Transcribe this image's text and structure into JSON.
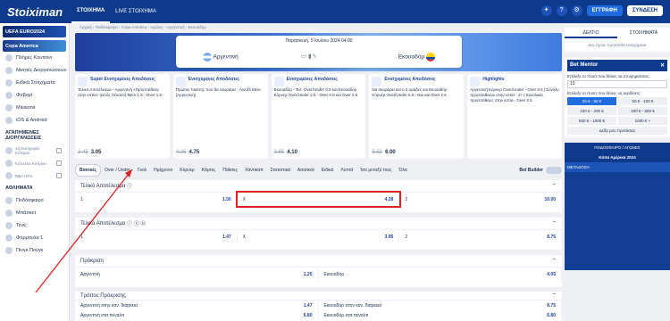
{
  "brand": "Stoiximan",
  "top_nav": [
    "ΣΤΟΙΧΗΜΑ",
    "LIVE ΣΤΟΙΧΗΜΑ"
  ],
  "top_actions": {
    "register": "ΕΓΓΡΑΦΗ",
    "login": "ΣΥΝΔΕΣΗ"
  },
  "sidebar": {
    "banners": [
      "UEFA EURO2024",
      "Copa America"
    ],
    "items": [
      "Πλήρες Κουπόνι",
      "Νικητές Διοργανώσεων",
      "Ειδικά Στοιχήματα",
      "Φαβορί",
      "Missions",
      "iOS & Android"
    ],
    "section": "ΑΓΑΠΗΜΕΝΕΣ ΔΙΟΡΓΑΝΩΣΕΙΣ",
    "favs": [
      "1η Κατηγορία Κύπρου",
      "Κύπελλο Κύπρου",
      "NBA ΗΠΑ"
    ],
    "sports_head": "ΑΘΛΗΜΑΤΑ",
    "sports": [
      "Ποδόσφαιρο",
      "Μπάσκετ",
      "Τένις",
      "Φόρμουλα 1",
      "Πινγκ Πονγκ"
    ]
  },
  "breadcrumb": "Αρχική › Ποδόσφαιρο › Copa America › Αγώνες › Αργεντινή - Εκουαδόρ",
  "event": {
    "date": "Παρασκευή, 5 Ιουλίου 2024 04:00",
    "home": "Αργεντινή",
    "away": "Εκουαδόρ"
  },
  "promos": [
    {
      "title": "Super Ενισχυμένες Αποδόσεις",
      "body": "Τελικό Αποτέλεσμα - Αργεντινή «Προσπάθειες στην εστία» (εκτός πέναλτι) Μέσι 1.5 - Over 1.5",
      "old": "2.45",
      "new": "3.05"
    },
    {
      "title": "Ενισχυμένες Αποδόσεις",
      "body": "Πρώτος παίκτης που θα σκοράρει - Λιονέλ Μέσι (Αργεντινή)",
      "old": "4.35",
      "new": "4.75"
    },
    {
      "title": "Ενισχυμένες Αποδόσεις",
      "body": "Εκουαδόρ - Τελ. Over/Under 0.5 και Εκουαδόρ Κόρνερ Over/Under 2.5 - Over 0.5 και Over 2.5",
      "old": "3.65",
      "new": "4.10"
    },
    {
      "title": "Ενισχυμένες Αποδόσεις",
      "body": "Να σκοράρει και ο 2 ομάδες και Εκουαδόρ Κόρνερ Over/Under 2.5 - Ναι και Over 2.5",
      "old": "5.50",
      "new": "6.00"
    },
    {
      "title": "Highlights",
      "body": "Αργεντινή Κόρνερ Over/Under - Over 8.5 | Σύνολο προσπαθειών στην εστία - 2+ | Συνολικές προσπάθειες στην εστία - Over 3.5",
      "old": "",
      "new": ""
    }
  ],
  "market_tabs": [
    "Βασικές",
    "Over / Under",
    "Γκολ",
    "Ημίχρονο",
    "Κόρνερ",
    "Κάρτες",
    "Παίκτες",
    "Χάντικαπ",
    "Στατιστικά",
    "Ασιατικά",
    "Ειδικά",
    "Λεπτά",
    "Ίσο μεταξύ τους",
    "Όλα"
  ],
  "bet_builder": "Bet Builder",
  "markets": [
    {
      "title": "Τελικό Αποτέλεσμα",
      "rows": [
        [
          [
            "1",
            "1.50"
          ],
          [
            "X",
            "4.28"
          ],
          [
            "2",
            "10.00"
          ]
        ]
      ]
    },
    {
      "title": "Τελικό Αποτέλεσμα",
      "rows": [
        [
          [
            "1",
            "1.47"
          ],
          [
            "X",
            "3.95"
          ],
          [
            "2",
            "8.75"
          ]
        ]
      ]
    },
    {
      "title": "Πρόκριση",
      "rows": [
        [
          [
            "Αργεντινή",
            "1.25"
          ],
          [
            "Εκουαδόρ",
            "4.05"
          ]
        ]
      ]
    },
    {
      "title": "Τρόπος Πρόκρισης",
      "rows": [
        [
          [
            "Αργεντινή στην καν. διάρκεια",
            "1.47"
          ],
          [
            "Εκουαδόρ στην καν. διάρκεια",
            "8.75"
          ]
        ],
        [
          [
            "Αργεντινή στα πέναλτι",
            "6.80"
          ],
          [
            "Εκουαδόρ στα πέναλτι",
            "6.80"
          ]
        ]
      ]
    }
  ],
  "right": {
    "tabs": [
      "ΔΕΛΤΙΟ",
      "ΣΤΟΙΧΗΜΑΤΑ"
    ],
    "empty": "Δεν έχουν προστεθεί στοιχήματα",
    "bm_title": "Bet Mentor",
    "bm_q1": "Επίλεξε το ποσό που θέλεις να στοιχηματίσεις:",
    "bm_amount": "10",
    "bm_q2": "Επίλεξε το ποσό που θέλεις να κερδίσεις:",
    "bm_opts": [
      "20 € - 50 €",
      "50 € - 100 €",
      "100 € - 200 €",
      "200 € - 500 €",
      "500 € - 1000 €",
      "1000 € +"
    ],
    "bm_go": "Δείξε μου προτάσεις",
    "live_head": "ΠΟΔΟΣΦΑΙΡΟ / ΑΓΩΝΕΣ",
    "live_comp": "Κόπα Αμέρικα 2024",
    "live_tab": "ΜΕΤΑΔΟΣΗ"
  }
}
